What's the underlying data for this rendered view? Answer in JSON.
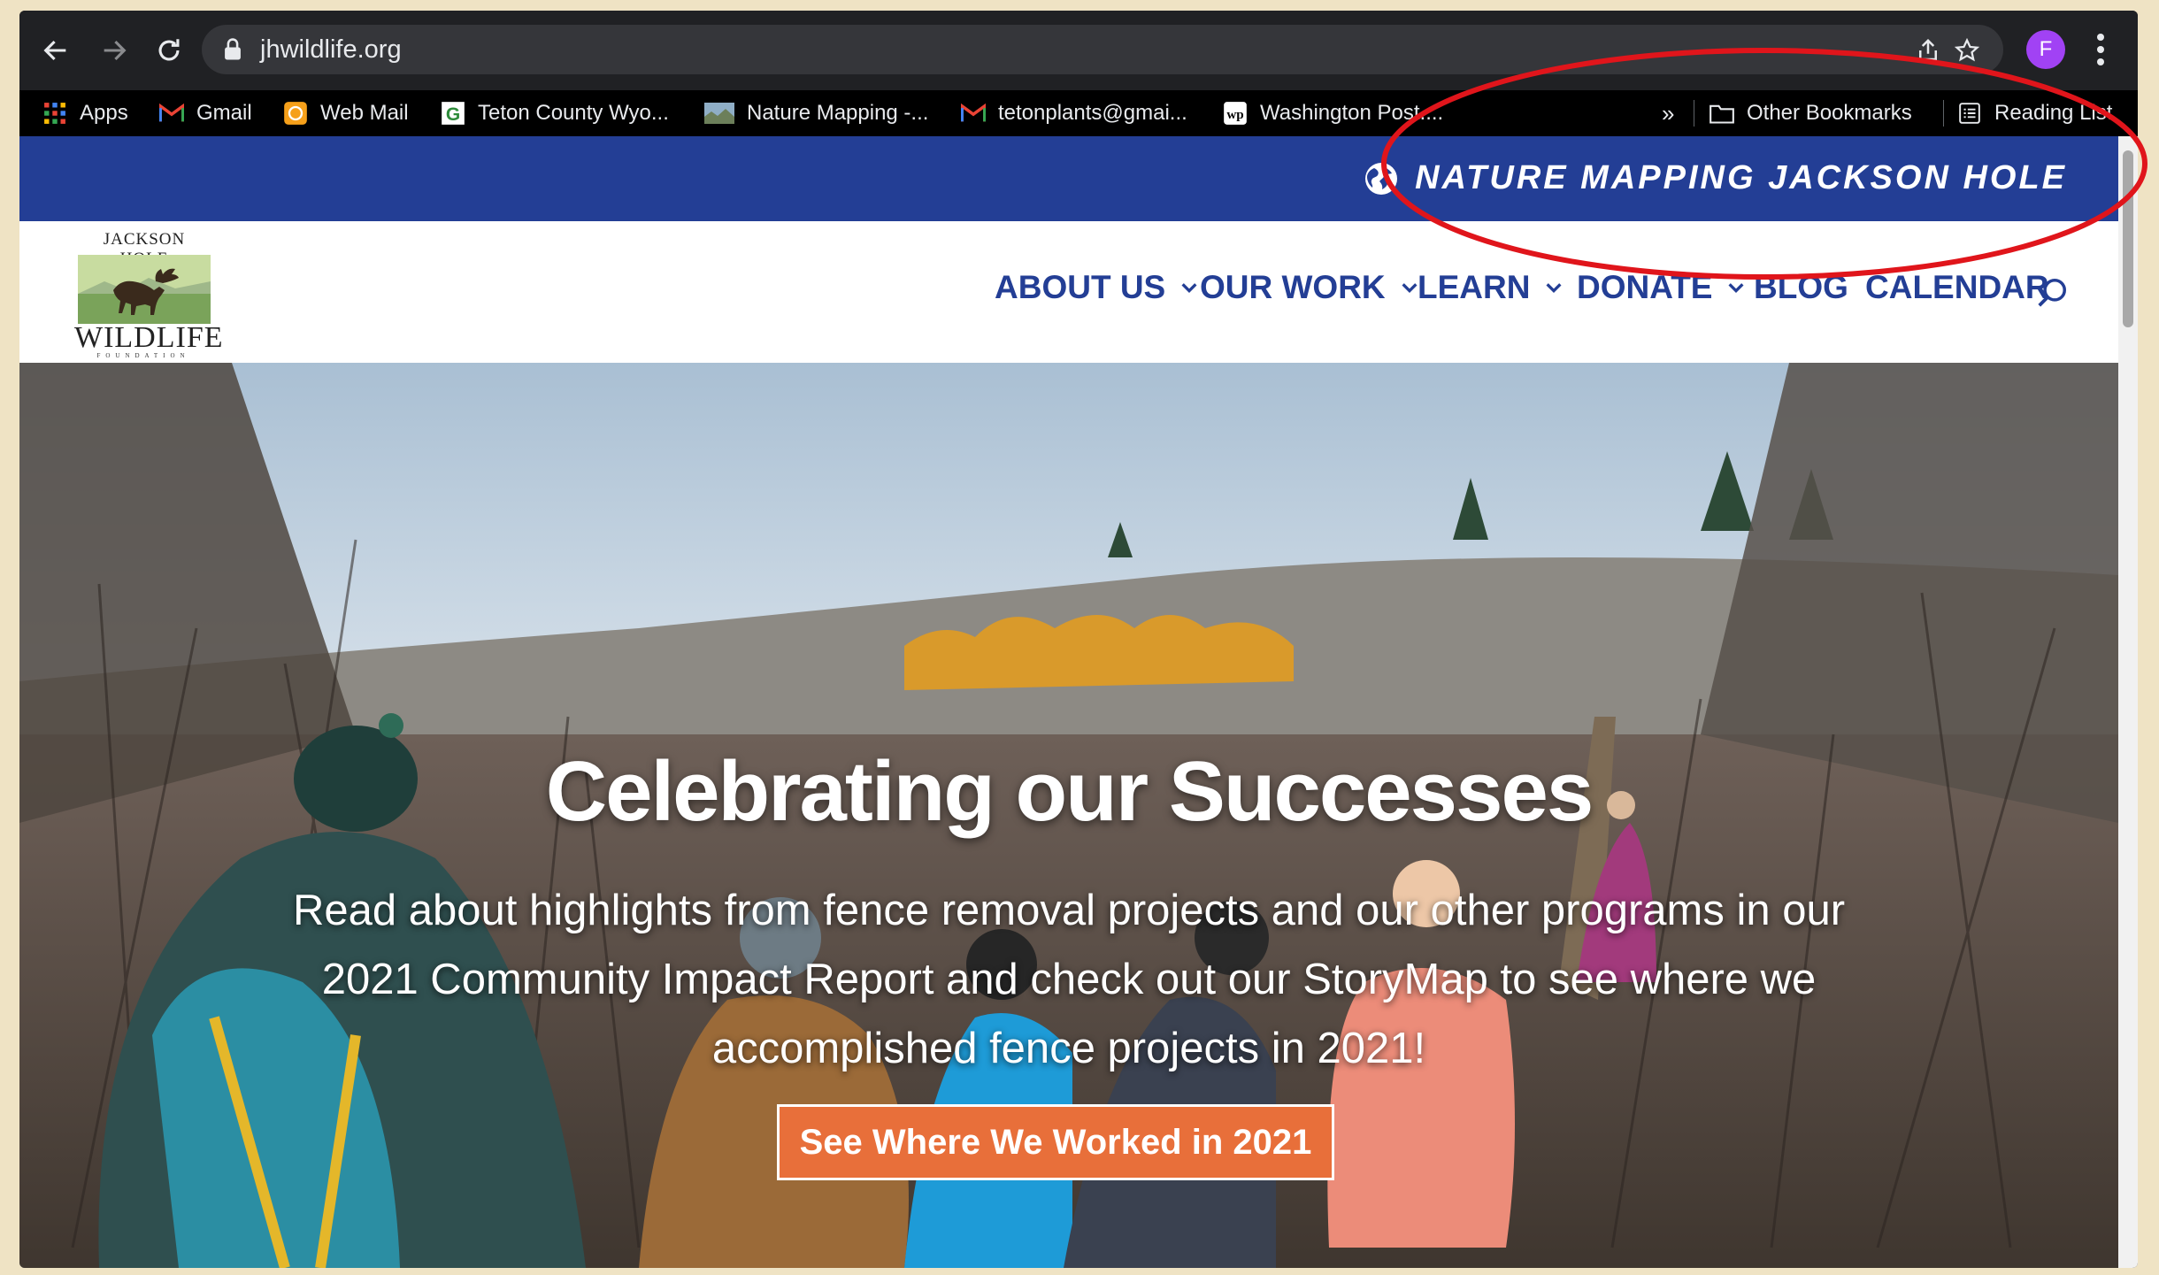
{
  "browser": {
    "url": "jhwildlife.org",
    "profile_initial": "F",
    "bookmarks": [
      {
        "label": "Apps",
        "icon": "apps-grid-icon"
      },
      {
        "label": "Gmail",
        "icon": "gmail-icon"
      },
      {
        "label": "Web Mail",
        "icon": "webmail-icon"
      },
      {
        "label": "Teton County Wyo...",
        "icon": "teton-county-icon"
      },
      {
        "label": "Nature Mapping -...",
        "icon": "nature-mapping-icon"
      },
      {
        "label": "tetonplants@gmai...",
        "icon": "gmail-icon"
      },
      {
        "label": "Washington Post....",
        "icon": "wapo-icon"
      }
    ],
    "overflow_label": "»",
    "other_bookmarks": "Other Bookmarks",
    "reading_list": "Reading List"
  },
  "site": {
    "topbar_link": "NATURE MAPPING JACKSON HOLE",
    "logo": {
      "line1": "JACKSON HOLE",
      "line2": "WILDLIFE",
      "line3": "FOUNDATION"
    },
    "nav": [
      {
        "label": "ABOUT US",
        "has_dropdown": true
      },
      {
        "label": "OUR WORK",
        "has_dropdown": true
      },
      {
        "label": "LEARN",
        "has_dropdown": true
      },
      {
        "label": "DONATE",
        "has_dropdown": true
      },
      {
        "label": "BLOG",
        "has_dropdown": false
      },
      {
        "label": "CALENDAR",
        "has_dropdown": false
      }
    ],
    "hero": {
      "title": "Celebrating our Successes",
      "text": "Read about highlights from fence removal projects and our other programs in our 2021 Community Impact Report and check out our StoryMap to see where we accomplished fence projects in 2021!",
      "button": "See Where We Worked in 2021"
    }
  },
  "colors": {
    "topbar_blue": "#233e95",
    "nav_text": "#233e95",
    "button_orange": "#e86f3a",
    "annotation_red": "#e0151b"
  }
}
